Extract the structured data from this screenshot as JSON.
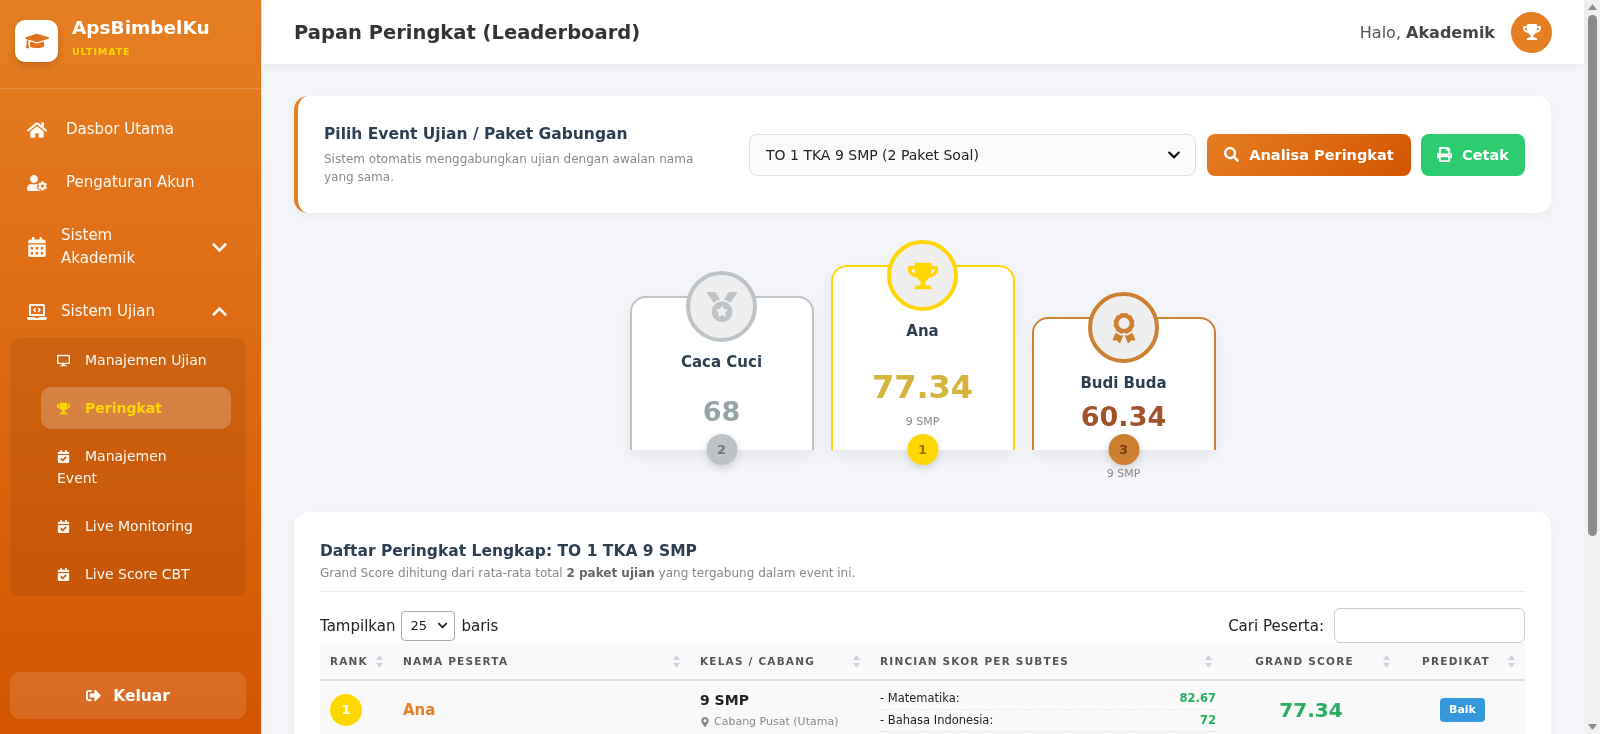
{
  "sidebar": {
    "brand": {
      "name": "ApsBimbelKu",
      "tier": "ULTIMATE"
    },
    "menu": [
      {
        "kind": "link",
        "label": "Dasbor Utama",
        "selected": false
      },
      {
        "kind": "link",
        "label": "Pengaturan Akun",
        "selected": false
      },
      {
        "kind": "group",
        "label": "Sistem Akademik",
        "selected": false,
        "expanded": false
      },
      {
        "kind": "group",
        "label": "Sistem Ujian",
        "selected": false,
        "expanded": true,
        "children": [
          {
            "label": "Manajemen Ujian",
            "selected": false
          },
          {
            "label": "Peringkat",
            "selected": true
          },
          {
            "label": "Manajemen Event",
            "selected": false
          },
          {
            "label": "Live Monitoring",
            "selected": false
          },
          {
            "label": "Live Score CBT",
            "selected": false
          }
        ]
      }
    ],
    "logout": {
      "label": "Keluar"
    }
  },
  "header": {
    "title": "Papan Peringkat (Leaderboard)",
    "greeting": "Halo, **Akademik**"
  },
  "event_filter": {
    "title": "Pilih Event Ujian / Paket Gabungan",
    "description": "Sistem otomatis menggabungkan ujian dengan awalan nama yang sama.",
    "event_select": {
      "value": "TO 1 TKA 9 SMP (2 Paket Soal)"
    },
    "buttons": [
      {
        "kind": "primary",
        "label": "Analisa Peringkat"
      },
      {
        "kind": "success",
        "label": "Cetak"
      }
    ]
  },
  "podium": [
    {
      "kind": "silver",
      "rank": "2",
      "name": "Caca Cuci",
      "score": "68"
    },
    {
      "kind": "gold",
      "rank": "1",
      "name": "Ana",
      "score": "77.34",
      "class": "9 SMP"
    },
    {
      "kind": "bronze",
      "rank": "3",
      "name": "Budi Buda",
      "score": "60.34",
      "class": "9 SMP"
    }
  ],
  "leaderboard": {
    "title": "Daftar Peringkat Lengkap: TO 1 TKA 9 SMP",
    "subtitle": "Grand Score dihitung dari rata-rata total **2 paket ujian** yang tergabung dalam event ini.",
    "page_length": {
      "label_before": "Tampilkan",
      "value": "25",
      "label_after": "baris"
    },
    "search": {
      "label": "Cari Peserta:"
    },
    "table": {
      "columns": [
        "RANK",
        "NAMA PESERTA",
        "KELAS / CABANG",
        "RINCIAN SKOR PER SUBTES",
        "GRAND SCORE",
        "PREDIKAT"
      ],
      "rows": [
        {
          "kind": "gold",
          "rank": "1",
          "name": "Ana",
          "class": "9 SMP",
          "branch": "Cabang Pusat (Utama)",
          "subtests": [
            {
              "name": "- Matematika:",
              "score": "82.67"
            },
            {
              "name": "- Bahasa Indonesia:",
              "score": "72"
            }
          ],
          "grand_score": "77.34",
          "predicate": "Baik"
        }
      ]
    }
  }
}
